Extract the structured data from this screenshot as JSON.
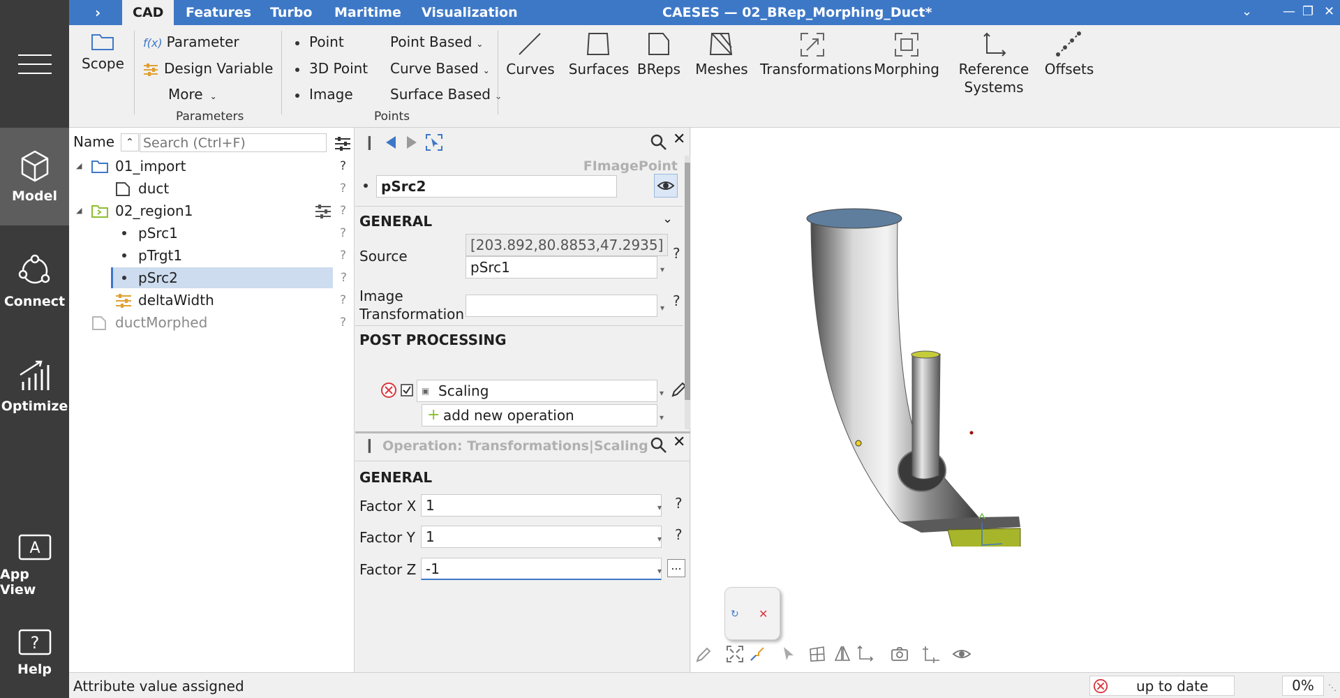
{
  "window": {
    "title": "CAESES — 02_BRep_Morphing_Duct*",
    "tabs": [
      "CAD",
      "Features",
      "Turbo",
      "Maritime",
      "Visualization"
    ],
    "active_tab": "CAD"
  },
  "leftnav": {
    "items": [
      {
        "label": "Model",
        "icon": "cube-icon",
        "active": true
      },
      {
        "label": "Connect",
        "icon": "connect-icon"
      },
      {
        "label": "Optimize",
        "icon": "chart-icon"
      },
      {
        "label": "App View",
        "icon": "app-icon"
      },
      {
        "label": "Help",
        "icon": "help-icon"
      }
    ]
  },
  "ribbon": {
    "scope": "Scope",
    "parameter": "Parameter",
    "design_variable": "Design Variable",
    "more": "More",
    "parameters_section": "Parameters",
    "point": "Point",
    "point_3d": "3D Point",
    "image": "Image",
    "point_based": "Point Based",
    "curve_based": "Curve Based",
    "surface_based": "Surface Based",
    "points_section": "Points",
    "curves": "Curves",
    "surfaces": "Surfaces",
    "breps": "BReps",
    "meshes": "Meshes",
    "transformations": "Transformations",
    "morphing": "Morphing",
    "reference_systems_1": "Reference",
    "reference_systems_2": "Systems",
    "offsets": "Offsets",
    "fx": "f(x)"
  },
  "tree": {
    "header": "Name",
    "search_placeholder": "Search (Ctrl+F)",
    "items": {
      "import": "01_import",
      "duct": "duct",
      "region1": "02_region1",
      "psrc1": "pSrc1",
      "ptrgt1": "pTrgt1",
      "psrc2": "pSrc2",
      "deltawidth": "deltaWidth",
      "ductmorphed": "ductMorphed"
    },
    "q": "?"
  },
  "props": {
    "type": "FImagePoint",
    "name": "pSrc2",
    "general": "GENERAL",
    "source_label": "Source",
    "source_coords": "[203.892,80.8853,47.2935]",
    "source_value": "pSrc1",
    "image_label_1": "Image",
    "image_label_2": "Transformation",
    "image_value": "",
    "post_processing": "POST PROCESSING",
    "op_name": "Scaling",
    "add_op": "add new operation",
    "operation_title": "Operation: Transformations|Scaling",
    "op_general": "GENERAL",
    "factor_x_label": "Factor  X",
    "factor_y_label": "Factor  Y",
    "factor_z_label": "Factor  Z",
    "factor_x": "1",
    "factor_y": "1",
    "factor_z": "-1",
    "q": "?",
    "ellipsis": "..."
  },
  "status": {
    "message": "Attribute value assigned",
    "state": "up to date",
    "percent": "0%"
  },
  "colors": {
    "titlebar": "#3d78c7",
    "sidebar": "#3b3b3b",
    "accent": "#3d78c7",
    "selection": "#cddcef",
    "duct_cap": "#5f7e9e",
    "duct_yellow": "#a7b52b",
    "error": "#d9363e"
  }
}
